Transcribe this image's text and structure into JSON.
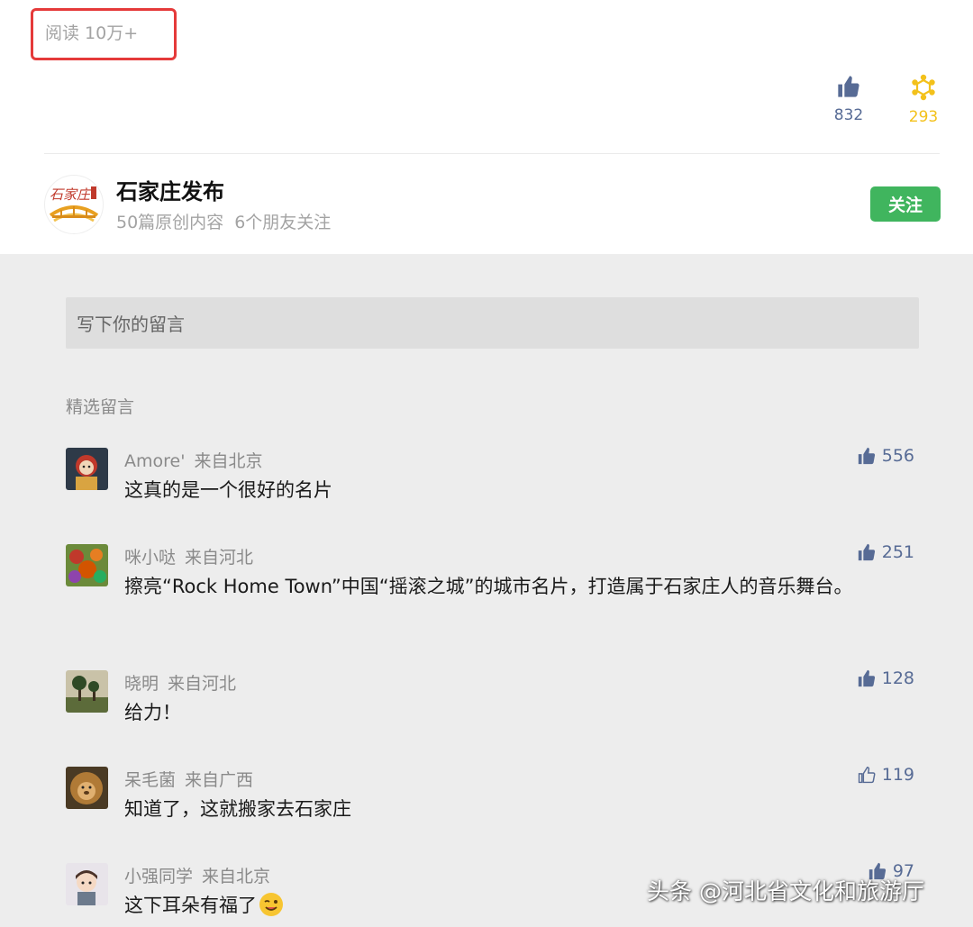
{
  "header": {
    "read_count": "阅读 10万+",
    "like_count": "832",
    "wow_count": "293",
    "like_icon": "thumbs-up-icon",
    "wow_icon": "wow-star-icon"
  },
  "account": {
    "name": "石家庄发布",
    "original_count": "50篇原创内容",
    "friends_follow": "6个朋友关注",
    "follow_label": "关注",
    "logo_text": "石家庄"
  },
  "comment_input": {
    "placeholder": "写下你的留言"
  },
  "comments_section": {
    "title": "精选留言",
    "items": [
      {
        "name": "Amore'",
        "location": "来自北京",
        "text": "这真的是一个很好的名片",
        "likes": "556",
        "liked": true
      },
      {
        "name": "咪小哒",
        "location": "来自河北",
        "text": "擦亮“Rock Home Town”中国“摇滚之城”的城市名片，打造属于石家庄人的音乐舞台。",
        "likes": "251",
        "liked": true
      },
      {
        "name": "晓明",
        "location": "来自河北",
        "text": "给力！",
        "likes": "128",
        "liked": true
      },
      {
        "name": "呆毛菌",
        "location": "来自广西",
        "text": "知道了，这就搬家去石家庄",
        "likes": "119",
        "liked": false
      },
      {
        "name": "小强同学",
        "location": "来自北京",
        "text": "这下耳朵有福了",
        "likes": "97",
        "liked": true
      }
    ]
  },
  "watermark": "头条 @河北省文化和旅游厅",
  "colors": {
    "accent_blue": "#576b95",
    "follow_green": "#40b55e",
    "wow_yellow": "#f3c11b",
    "highlight_red": "#e53a3a"
  }
}
